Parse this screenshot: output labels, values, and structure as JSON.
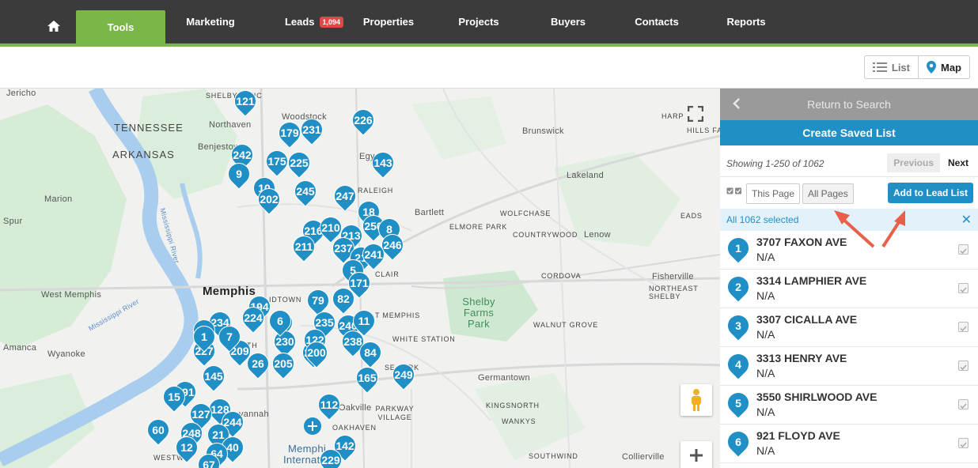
{
  "nav": {
    "items": [
      {
        "label": "Tools",
        "active": true
      },
      {
        "label": "Marketing"
      },
      {
        "label": "Leads",
        "badge": "1,094"
      },
      {
        "label": "Properties"
      },
      {
        "label": "Projects"
      },
      {
        "label": "Buyers"
      },
      {
        "label": "Contacts"
      },
      {
        "label": "Reports"
      }
    ]
  },
  "view_toggle": {
    "list": "List",
    "map": "Map"
  },
  "map": {
    "labels": {
      "jericho": "Jericho",
      "civic": "SHELBY CIVIC",
      "northaven": "Northaven",
      "benjestown": "Benjestown",
      "woodstock": "Woodstock",
      "egypt": "Egy",
      "raleigh": "RALEIGH",
      "tennessee": "TENNESSEE",
      "arkansas": "ARKANSAS",
      "marion": "Marion",
      "spur": "Spur",
      "memphis": "Memphis",
      "west_memphis": "West Memphis",
      "amanca": "Amanca",
      "wyanoke": "Wyanoke",
      "midtown": "IDTOWN",
      "brunswick": "Brunswick",
      "lakeland": "Lakeland",
      "bartlett": "Bartlett",
      "wolfchase": "WOLFCHASE",
      "elmore_park": "ELMORE PARK",
      "countrywood": "COUNTRYWOOD",
      "lenow": "Lenow",
      "eads": "EADS",
      "harp": "HARP",
      "hills_farm": "HILLS FARM",
      "cordova": "CORDOVA",
      "fisherville": "Fisherville",
      "northeast_shelby": "NORTHEAST SHELBY",
      "shelby_farms_park": "Shelby Farms Park",
      "walnut_grove": "WALNUT GROVE",
      "east_memphis": "T MEMPHIS",
      "white_station": "WHITE STATION",
      "selma_park": "SE    PARK",
      "germantown": "Germantown",
      "parkway_village": "PARKWAY VILLAGE",
      "oakville": "Oakville",
      "oakhaven": "OAKHAVEN",
      "kingsnorth": "KINGSNORTH",
      "wamkys": "WANKYS",
      "collierville": "Collierville",
      "southwind": "SOUTHWIND",
      "westwood": "WESTWO",
      "savannah": "vannah",
      "clair": "CLAIR",
      "memphis_intl": "Memphi",
      "memphis_intl2": "Internat",
      "mississippi_river": "Mississippi River",
      "mississippi_river2": "Mississippi River",
      "south": "SOUTH"
    },
    "pins": [
      "121",
      "179",
      "231",
      "226",
      "242",
      "175",
      "225",
      "143",
      "9",
      "10",
      "202",
      "245",
      "247",
      "18",
      "250",
      "216",
      "210",
      "213",
      "8",
      "246",
      "211",
      "237",
      "21",
      "241",
      "5",
      "171",
      "82",
      "79",
      "194",
      "224",
      "54",
      "235",
      "240",
      "11",
      "234",
      "18",
      "230",
      "229",
      "209",
      "227",
      "122",
      "238",
      "200",
      "84",
      "26",
      "205",
      "165",
      "249",
      "145",
      "191",
      "15",
      "128",
      "127",
      "244",
      "60",
      "248",
      "21",
      "40",
      "142",
      "229",
      "12",
      "64",
      "67",
      "112",
      "6",
      "7",
      "1"
    ]
  },
  "sidebar": {
    "return": "Return to Search",
    "create": "Create Saved List",
    "showing": "Showing 1-250 of 1062",
    "prev": "Previous",
    "next": "Next",
    "this_page": "This Page",
    "all_pages": "All Pages",
    "add_lead": "Add to Lead List",
    "selected": "All 1062 selected",
    "close": "✕",
    "results": [
      {
        "num": "1",
        "addr": "3707 FAXON AVE",
        "sub": "N/A"
      },
      {
        "num": "2",
        "addr": "3314 LAMPHIER AVE",
        "sub": "N/A"
      },
      {
        "num": "3",
        "addr": "3307 CICALLA AVE",
        "sub": "N/A"
      },
      {
        "num": "4",
        "addr": "3313 HENRY AVE",
        "sub": "N/A"
      },
      {
        "num": "5",
        "addr": "3550 SHIRLWOOD AVE",
        "sub": "N/A"
      },
      {
        "num": "6",
        "addr": "921 FLOYD AVE",
        "sub": "N/A"
      }
    ]
  },
  "colors": {
    "nav_bg": "#3b3b3b",
    "accent_green": "#7ab648",
    "accent_blue": "#1f8fc6",
    "arrow": "#e8604a"
  }
}
